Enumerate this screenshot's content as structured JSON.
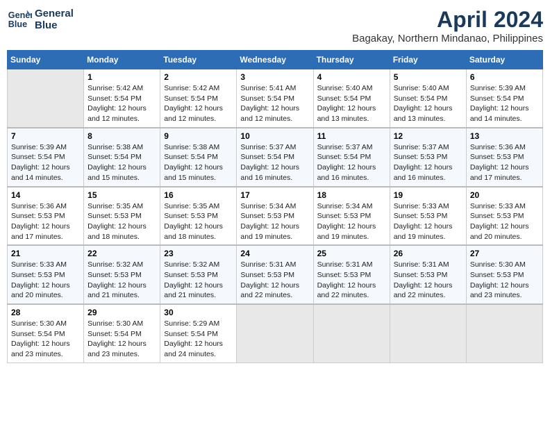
{
  "header": {
    "logo_line1": "General",
    "logo_line2": "Blue",
    "title": "April 2024",
    "subtitle": "Bagakay, Northern Mindanao, Philippines"
  },
  "calendar": {
    "days_of_week": [
      "Sunday",
      "Monday",
      "Tuesday",
      "Wednesday",
      "Thursday",
      "Friday",
      "Saturday"
    ],
    "weeks": [
      [
        {
          "num": "",
          "info": ""
        },
        {
          "num": "1",
          "info": "Sunrise: 5:42 AM\nSunset: 5:54 PM\nDaylight: 12 hours\nand 12 minutes."
        },
        {
          "num": "2",
          "info": "Sunrise: 5:42 AM\nSunset: 5:54 PM\nDaylight: 12 hours\nand 12 minutes."
        },
        {
          "num": "3",
          "info": "Sunrise: 5:41 AM\nSunset: 5:54 PM\nDaylight: 12 hours\nand 12 minutes."
        },
        {
          "num": "4",
          "info": "Sunrise: 5:40 AM\nSunset: 5:54 PM\nDaylight: 12 hours\nand 13 minutes."
        },
        {
          "num": "5",
          "info": "Sunrise: 5:40 AM\nSunset: 5:54 PM\nDaylight: 12 hours\nand 13 minutes."
        },
        {
          "num": "6",
          "info": "Sunrise: 5:39 AM\nSunset: 5:54 PM\nDaylight: 12 hours\nand 14 minutes."
        }
      ],
      [
        {
          "num": "7",
          "info": "Sunrise: 5:39 AM\nSunset: 5:54 PM\nDaylight: 12 hours\nand 14 minutes."
        },
        {
          "num": "8",
          "info": "Sunrise: 5:38 AM\nSunset: 5:54 PM\nDaylight: 12 hours\nand 15 minutes."
        },
        {
          "num": "9",
          "info": "Sunrise: 5:38 AM\nSunset: 5:54 PM\nDaylight: 12 hours\nand 15 minutes."
        },
        {
          "num": "10",
          "info": "Sunrise: 5:37 AM\nSunset: 5:54 PM\nDaylight: 12 hours\nand 16 minutes."
        },
        {
          "num": "11",
          "info": "Sunrise: 5:37 AM\nSunset: 5:54 PM\nDaylight: 12 hours\nand 16 minutes."
        },
        {
          "num": "12",
          "info": "Sunrise: 5:37 AM\nSunset: 5:53 PM\nDaylight: 12 hours\nand 16 minutes."
        },
        {
          "num": "13",
          "info": "Sunrise: 5:36 AM\nSunset: 5:53 PM\nDaylight: 12 hours\nand 17 minutes."
        }
      ],
      [
        {
          "num": "14",
          "info": "Sunrise: 5:36 AM\nSunset: 5:53 PM\nDaylight: 12 hours\nand 17 minutes."
        },
        {
          "num": "15",
          "info": "Sunrise: 5:35 AM\nSunset: 5:53 PM\nDaylight: 12 hours\nand 18 minutes."
        },
        {
          "num": "16",
          "info": "Sunrise: 5:35 AM\nSunset: 5:53 PM\nDaylight: 12 hours\nand 18 minutes."
        },
        {
          "num": "17",
          "info": "Sunrise: 5:34 AM\nSunset: 5:53 PM\nDaylight: 12 hours\nand 19 minutes."
        },
        {
          "num": "18",
          "info": "Sunrise: 5:34 AM\nSunset: 5:53 PM\nDaylight: 12 hours\nand 19 minutes."
        },
        {
          "num": "19",
          "info": "Sunrise: 5:33 AM\nSunset: 5:53 PM\nDaylight: 12 hours\nand 19 minutes."
        },
        {
          "num": "20",
          "info": "Sunrise: 5:33 AM\nSunset: 5:53 PM\nDaylight: 12 hours\nand 20 minutes."
        }
      ],
      [
        {
          "num": "21",
          "info": "Sunrise: 5:33 AM\nSunset: 5:53 PM\nDaylight: 12 hours\nand 20 minutes."
        },
        {
          "num": "22",
          "info": "Sunrise: 5:32 AM\nSunset: 5:53 PM\nDaylight: 12 hours\nand 21 minutes."
        },
        {
          "num": "23",
          "info": "Sunrise: 5:32 AM\nSunset: 5:53 PM\nDaylight: 12 hours\nand 21 minutes."
        },
        {
          "num": "24",
          "info": "Sunrise: 5:31 AM\nSunset: 5:53 PM\nDaylight: 12 hours\nand 22 minutes."
        },
        {
          "num": "25",
          "info": "Sunrise: 5:31 AM\nSunset: 5:53 PM\nDaylight: 12 hours\nand 22 minutes."
        },
        {
          "num": "26",
          "info": "Sunrise: 5:31 AM\nSunset: 5:53 PM\nDaylight: 12 hours\nand 22 minutes."
        },
        {
          "num": "27",
          "info": "Sunrise: 5:30 AM\nSunset: 5:53 PM\nDaylight: 12 hours\nand 23 minutes."
        }
      ],
      [
        {
          "num": "28",
          "info": "Sunrise: 5:30 AM\nSunset: 5:54 PM\nDaylight: 12 hours\nand 23 minutes."
        },
        {
          "num": "29",
          "info": "Sunrise: 5:30 AM\nSunset: 5:54 PM\nDaylight: 12 hours\nand 23 minutes."
        },
        {
          "num": "30",
          "info": "Sunrise: 5:29 AM\nSunset: 5:54 PM\nDaylight: 12 hours\nand 24 minutes."
        },
        {
          "num": "",
          "info": ""
        },
        {
          "num": "",
          "info": ""
        },
        {
          "num": "",
          "info": ""
        },
        {
          "num": "",
          "info": ""
        }
      ]
    ]
  }
}
